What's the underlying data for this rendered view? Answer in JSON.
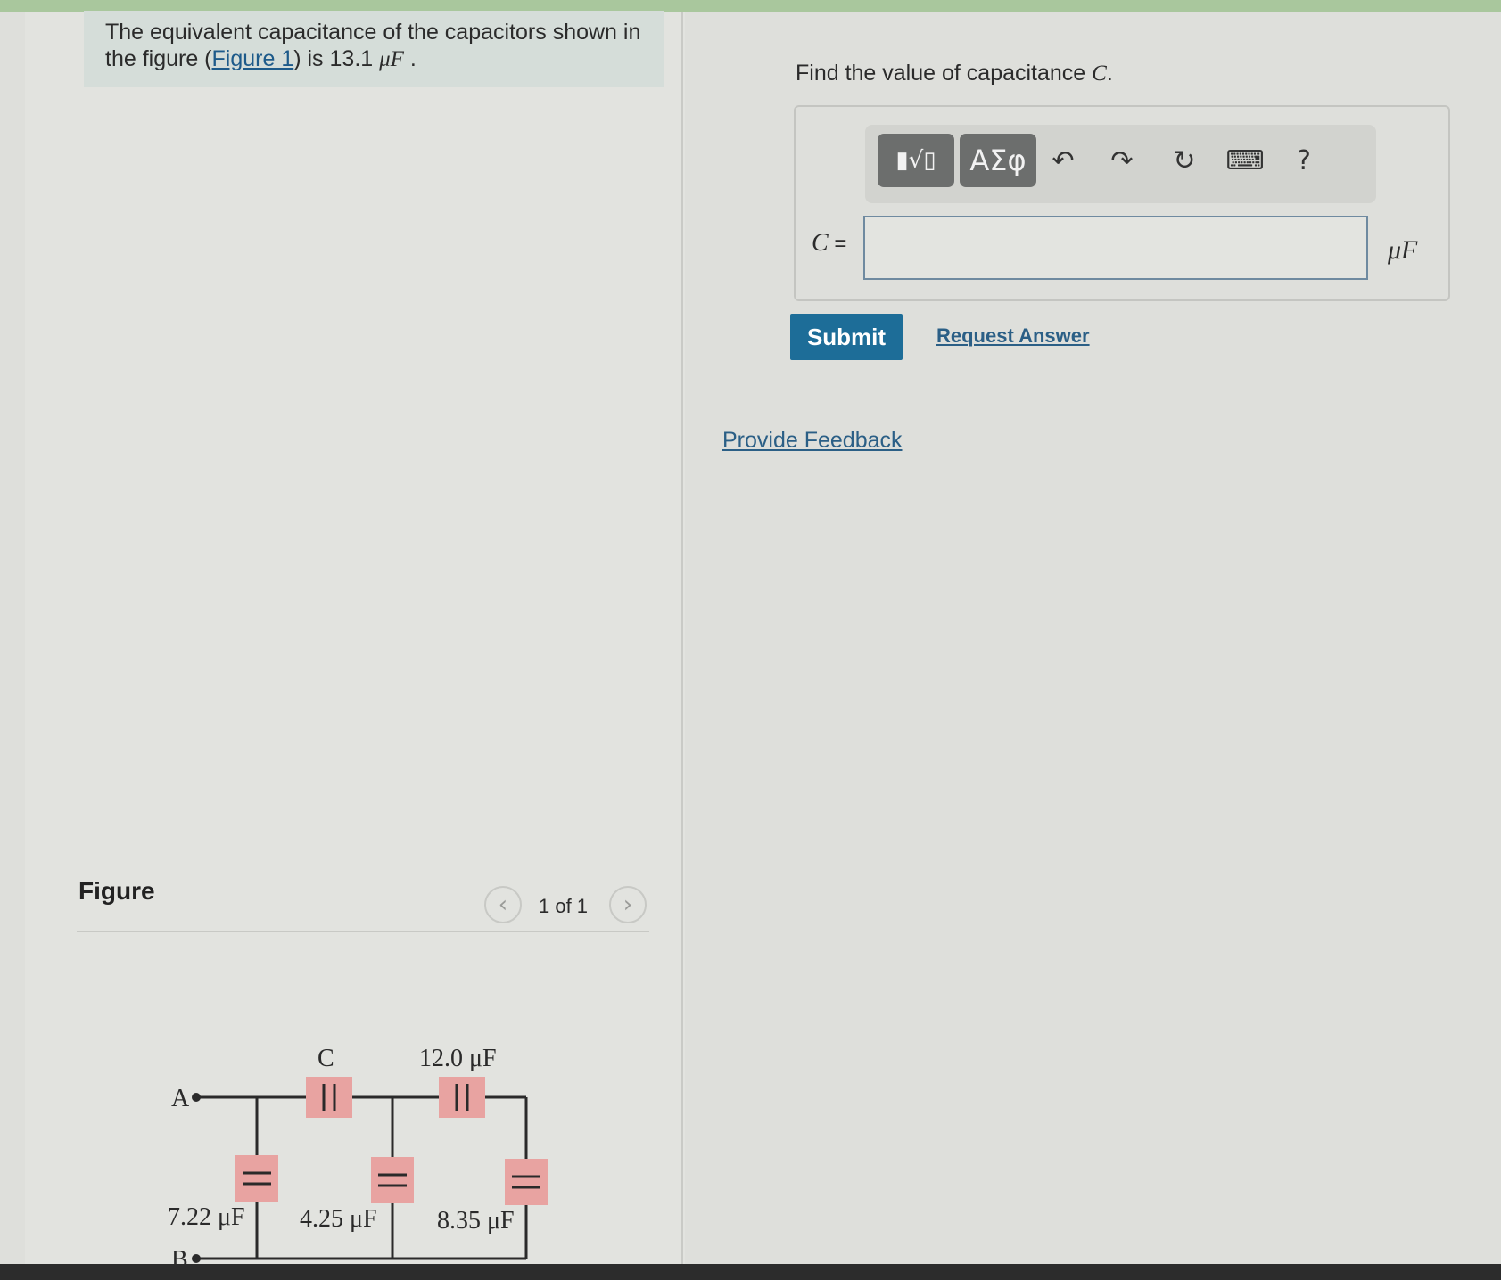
{
  "prompt": {
    "text_start": "The equivalent capacitance of the capacitors shown in",
    "text_line2_a": "the figure (",
    "figure_link": "Figure 1",
    "text_line2_b": ") is 13.1",
    "unit": "μF",
    "end": "."
  },
  "question": {
    "text": "Find the value of capacitance",
    "var": "C",
    "end": "."
  },
  "toolbar": {
    "templates_button": "▮√▯",
    "symbols_button": "ΑΣφ",
    "undo_icon": "↶",
    "redo_icon": "↷",
    "reset_icon": "↻",
    "keyboard_icon": "⌨",
    "help_icon": "?"
  },
  "answer": {
    "label_var": "C",
    "label_eq": " =",
    "value": "",
    "unit": "μF"
  },
  "actions": {
    "submit": "Submit",
    "request_answer": "Request Answer",
    "provide_feedback": "Provide Feedback"
  },
  "figure": {
    "title": "Figure",
    "pager": "1 of 1",
    "prev_icon": "‹",
    "next_icon": "›",
    "labels": {
      "node_a": "A",
      "node_b": "B",
      "cap_c": "C",
      "cap_top_right": "12.0 μF",
      "cap_left": "7.22 μF",
      "cap_middle": "4.25 μF",
      "cap_right": "8.35 μF"
    }
  },
  "colors": {
    "capacitor_highlight": "#e8a3a1",
    "submit_bg": "#1d6d98",
    "link": "#2b5f86"
  }
}
